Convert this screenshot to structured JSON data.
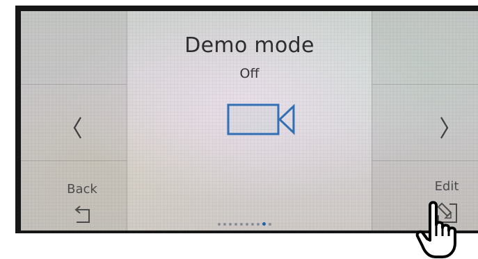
{
  "screen": {
    "title": "Demo mode",
    "value": "Off",
    "mode_icon": "video-camera-icon",
    "accent_color": "#2f6fb6"
  },
  "nav": {
    "prev_icon": "chevron-left-icon",
    "next_icon": "chevron-right-icon"
  },
  "softkeys": {
    "back_label": "Back",
    "back_icon": "return-arrow-icon",
    "edit_label": "Edit",
    "edit_icon": "edit-pencil-icon"
  },
  "pager": {
    "page_count": 10,
    "active_page": 9
  },
  "overlay": {
    "pointer_icon": "hand-pointer-icon"
  }
}
